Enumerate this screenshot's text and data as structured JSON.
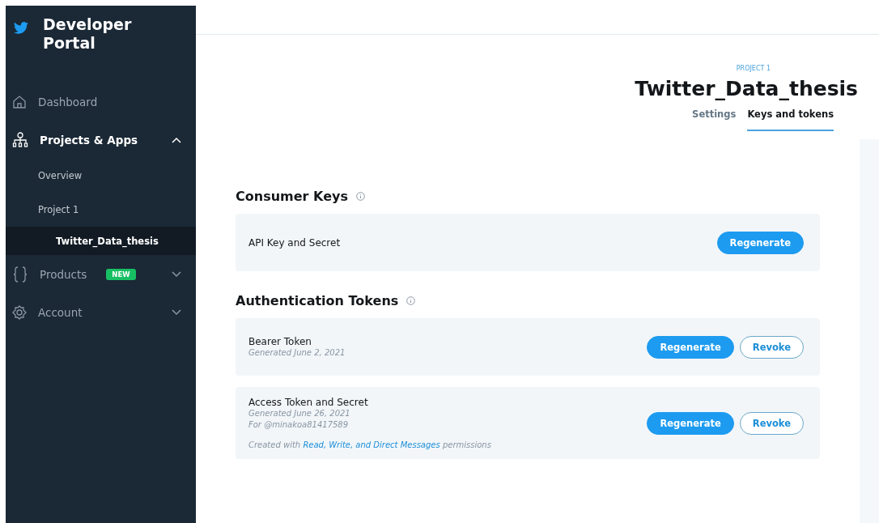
{
  "sidebar": {
    "brand": "Developer\nPortal",
    "items": [
      {
        "label": "Dashboard",
        "selected": false
      },
      {
        "label": "Projects & Apps",
        "selected": true,
        "expanded": true,
        "children": [
          {
            "label": "Overview",
            "selected": false
          },
          {
            "label": "Project 1",
            "selected": false,
            "children": [
              {
                "label": "Twitter_Data_thesis",
                "selected": true
              }
            ]
          }
        ]
      },
      {
        "label": "Products",
        "badge": "NEW",
        "selected": false,
        "expanded": false
      },
      {
        "label": "Account",
        "selected": false,
        "expanded": false
      }
    ]
  },
  "header": {
    "eyebrow": "PROJECT 1",
    "title": "Twitter_Data_thesis",
    "tabs": [
      {
        "label": "Settings",
        "selected": false
      },
      {
        "label": "Keys and tokens",
        "selected": true
      }
    ]
  },
  "sections": [
    {
      "title": "Consumer Keys",
      "cards": [
        {
          "title": "API Key and Secret",
          "buttons": [
            {
              "label": "Regenerate",
              "kind": "primary"
            }
          ]
        }
      ]
    },
    {
      "title": "Authentication Tokens",
      "cards": [
        {
          "title": "Bearer Token",
          "meta": [
            "Generated June 2, 2021"
          ],
          "buttons": [
            {
              "label": "Regenerate",
              "kind": "primary"
            },
            {
              "label": "Revoke",
              "kind": "outline"
            }
          ]
        },
        {
          "title": "Access Token and Secret",
          "meta": [
            "Generated June 26, 2021",
            "For @minakoa81417589"
          ],
          "note": {
            "before": "Created with",
            "link": "Read, Write, and Direct Messages",
            "after": "permissions"
          },
          "buttons": [
            {
              "label": "Regenerate",
              "kind": "primary"
            },
            {
              "label": "Revoke",
              "kind": "outline"
            }
          ]
        }
      ]
    }
  ]
}
